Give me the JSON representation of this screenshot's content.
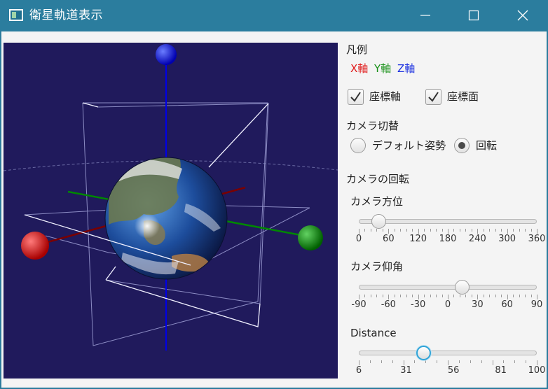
{
  "window": {
    "title": "衛星軌道表示"
  },
  "legend": {
    "heading": "凡例",
    "x": "X軸",
    "y": "Y軸",
    "z": "Z軸"
  },
  "options": {
    "axes_label": "座標軸",
    "axes_checked": true,
    "planes_label": "座標面",
    "planes_checked": true
  },
  "camera_switch": {
    "heading": "カメラ切替",
    "default_label": "デフォルト姿勢",
    "default_selected": false,
    "rotate_label": "回転",
    "rotate_selected": true
  },
  "camera_rotation": {
    "heading": "カメラの回転",
    "azimuth": {
      "label": "カメラ方位",
      "min": 0,
      "max": 360,
      "value": 40,
      "ticks": [
        "0",
        "60",
        "120",
        "180",
        "240",
        "300",
        "360"
      ]
    },
    "elevation": {
      "label": "カメラ仰角",
      "min": -90,
      "max": 90,
      "value": 14,
      "ticks": [
        "-90",
        "-60",
        "-30",
        "0",
        "30",
        "60",
        "90"
      ]
    },
    "distance": {
      "label": "Distance",
      "min": 6,
      "max": 100,
      "value": 40,
      "ticks": [
        "6",
        "31",
        "56",
        "81",
        "100"
      ],
      "tick_values": [
        6,
        31,
        56,
        81,
        100
      ]
    }
  },
  "colors": {
    "x_axis": "#e01818",
    "y_axis": "#169016",
    "z_axis": "#1a2fe0",
    "scene_bg": "#201a5c",
    "titlebar": "#2b7d9e"
  }
}
